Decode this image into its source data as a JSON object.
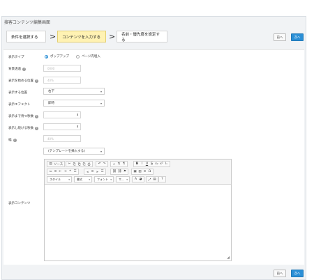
{
  "window": {
    "title": "接客コンテンツ編集画面"
  },
  "steps": {
    "step1": "条件を選択する",
    "step2": "コンテンツを入力する",
    "step3": "名前・優先度を設定する",
    "arrow": ">"
  },
  "nav": {
    "prev": "前へ",
    "next": "次へ"
  },
  "form": {
    "display_type": {
      "label": "表示タイプ",
      "options": [
        "ポップアップ",
        "ページ内埋入"
      ],
      "selected": "ポップアップ"
    },
    "opacity": {
      "label": "背景透過",
      "placeholder": "0000"
    },
    "start_position": {
      "label": "表示を始める位置",
      "placeholder": "40%"
    },
    "position": {
      "label": "表示する位置",
      "value": "右下"
    },
    "effect": {
      "label": "表示エフェクト",
      "value": "即時"
    },
    "wait_seconds": {
      "label": "表示まで待つ秒数"
    },
    "keep_seconds": {
      "label": "表示し続ける秒数"
    },
    "width": {
      "label": "幅",
      "placeholder": "40%"
    },
    "template": {
      "value": "(テンプレートを挿入する)"
    },
    "content": {
      "label": "表示コンテンツ"
    }
  },
  "editor": {
    "source_label": "ソース",
    "combos": [
      "スタイル",
      "書式",
      "フォント",
      "サ..."
    ],
    "row1_groups": [
      [
        "▤",
        "ソース"
      ],
      [
        "✂",
        "⎘",
        "⎗",
        "⎘",
        "⎙"
      ],
      [
        "↶",
        "↷"
      ],
      [
        "⌕",
        "⇆",
        "¶"
      ],
      [
        "B",
        "I",
        "U",
        "S",
        "x₂",
        "x²",
        "Ix"
      ]
    ],
    "row2_groups": [
      [
        "≔",
        "≡",
        "⇤",
        "⇥",
        "❝",
        "☰"
      ],
      [
        "⫷",
        "≡",
        "⫸",
        "☰"
      ],
      [
        "⛓",
        "⛓",
        "⚑"
      ],
      [
        "▣",
        "▥",
        "≡",
        "Ω"
      ]
    ],
    "row3_tail": [
      "A",
      "◕",
      "⤢",
      "▤",
      "?"
    ]
  },
  "icons": {
    "help": "help-icon",
    "caret": "chevron-down-icon",
    "spinner": "spinner-icon",
    "resize": "resize-handle-icon"
  },
  "colors": {
    "accent": "#2b8fd6",
    "active_step": "#fff2b3"
  }
}
